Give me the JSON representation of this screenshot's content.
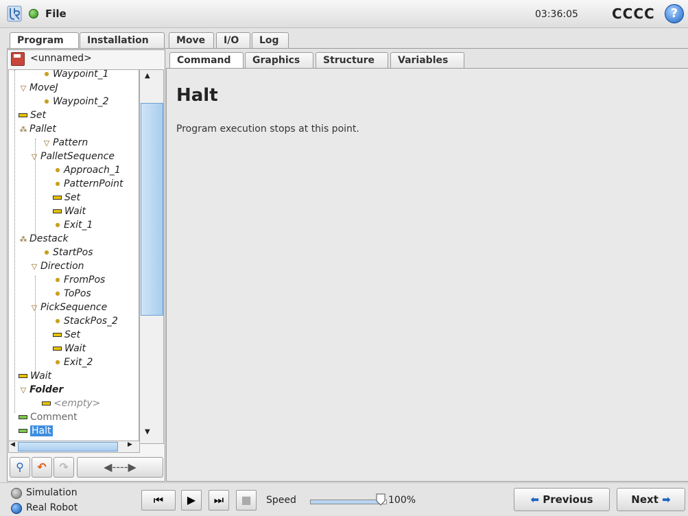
{
  "header": {
    "file_label": "File",
    "clock": "03:36:05",
    "robot_name": "CCCC",
    "help_symbol": "?"
  },
  "main_tabs": [
    {
      "label": "Program",
      "active": true
    },
    {
      "label": "Installation",
      "active": false
    },
    {
      "label": "Move",
      "active": false
    },
    {
      "label": "I/O",
      "active": false
    },
    {
      "label": "Log",
      "active": false
    }
  ],
  "sub_tabs": [
    {
      "label": "Command",
      "active": true
    },
    {
      "label": "Graphics",
      "active": false
    },
    {
      "label": "Structure",
      "active": false
    },
    {
      "label": "Variables",
      "active": false
    }
  ],
  "program": {
    "name": "<unnamed>"
  },
  "tree": [
    {
      "label": "Waypoint_1",
      "icon": "waypoint-icon",
      "indent": 2
    },
    {
      "label": "MoveJ",
      "icon": "folder-triangle-icon",
      "indent": 0
    },
    {
      "label": "Waypoint_2",
      "icon": "waypoint-icon",
      "indent": 2
    },
    {
      "label": "Set",
      "icon": "set-icon",
      "indent": 0
    },
    {
      "label": "Pallet",
      "icon": "pallet-icon",
      "indent": 0
    },
    {
      "label": "Pattern",
      "icon": "folder-triangle-icon",
      "indent": 2
    },
    {
      "label": "PalletSequence",
      "icon": "folder-triangle-icon",
      "indent": 1
    },
    {
      "label": "Approach_1",
      "icon": "waypoint-icon",
      "indent": 3
    },
    {
      "label": "PatternPoint",
      "icon": "waypoint-icon",
      "indent": 3
    },
    {
      "label": "Set",
      "icon": "set-icon",
      "indent": 3
    },
    {
      "label": "Wait",
      "icon": "set-icon",
      "indent": 3
    },
    {
      "label": "Exit_1",
      "icon": "waypoint-icon",
      "indent": 3
    },
    {
      "label": "Destack",
      "icon": "pallet-icon",
      "indent": 0
    },
    {
      "label": "StartPos",
      "icon": "waypoint-icon",
      "indent": 2
    },
    {
      "label": "Direction",
      "icon": "folder-triangle-icon",
      "indent": 1
    },
    {
      "label": "FromPos",
      "icon": "waypoint-icon",
      "indent": 3
    },
    {
      "label": "ToPos",
      "icon": "waypoint-icon",
      "indent": 3
    },
    {
      "label": "PickSequence",
      "icon": "folder-triangle-icon",
      "indent": 1
    },
    {
      "label": "StackPos_2",
      "icon": "waypoint-icon",
      "indent": 3
    },
    {
      "label": "Set",
      "icon": "set-icon",
      "indent": 3
    },
    {
      "label": "Wait",
      "icon": "set-icon",
      "indent": 3
    },
    {
      "label": "Exit_2",
      "icon": "waypoint-icon",
      "indent": 3
    },
    {
      "label": "Wait",
      "icon": "set-icon",
      "indent": 0
    },
    {
      "label": "Folder",
      "icon": "folder-triangle-icon",
      "indent": 0,
      "bold": true
    },
    {
      "label": "<empty>",
      "icon": "set-icon",
      "indent": 2,
      "grey": true
    },
    {
      "label": "Comment",
      "icon": "green-icon",
      "indent": 0,
      "plain": true
    },
    {
      "label": "Halt",
      "icon": "green-icon",
      "indent": 0,
      "plain": true,
      "selected": true
    }
  ],
  "content": {
    "title": "Halt",
    "description": "Program execution stops at this point."
  },
  "footer": {
    "simulation_label": "Simulation",
    "real_robot_label": "Real Robot",
    "speed_label": "Speed",
    "speed_value": "100%",
    "speed_fraction": 1.0,
    "previous_label": "Previous",
    "next_label": "Next"
  },
  "colors": {
    "accent_blue": "#1c64c4",
    "status_green": "#2b8a1c",
    "selection": "#3d8ee0"
  }
}
